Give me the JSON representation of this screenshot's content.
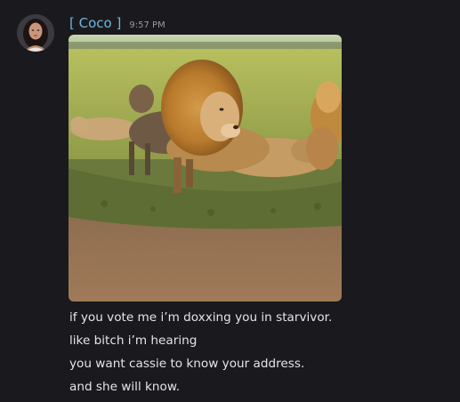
{
  "message": {
    "username": "[ Coco ]",
    "timestamp": "9:57 PM",
    "lines": [
      "if you vote me i’m doxxing you in starvivor.",
      "like bitch i’m hearing",
      "you want cassie to know your address.",
      "and she will know."
    ]
  },
  "media": {
    "icon": "lion-gif-image"
  },
  "colors": {
    "background": "#1a1a1e",
    "username": "#6fb7d9",
    "timestamp": "#949ba4",
    "text": "#e3e5e8"
  }
}
